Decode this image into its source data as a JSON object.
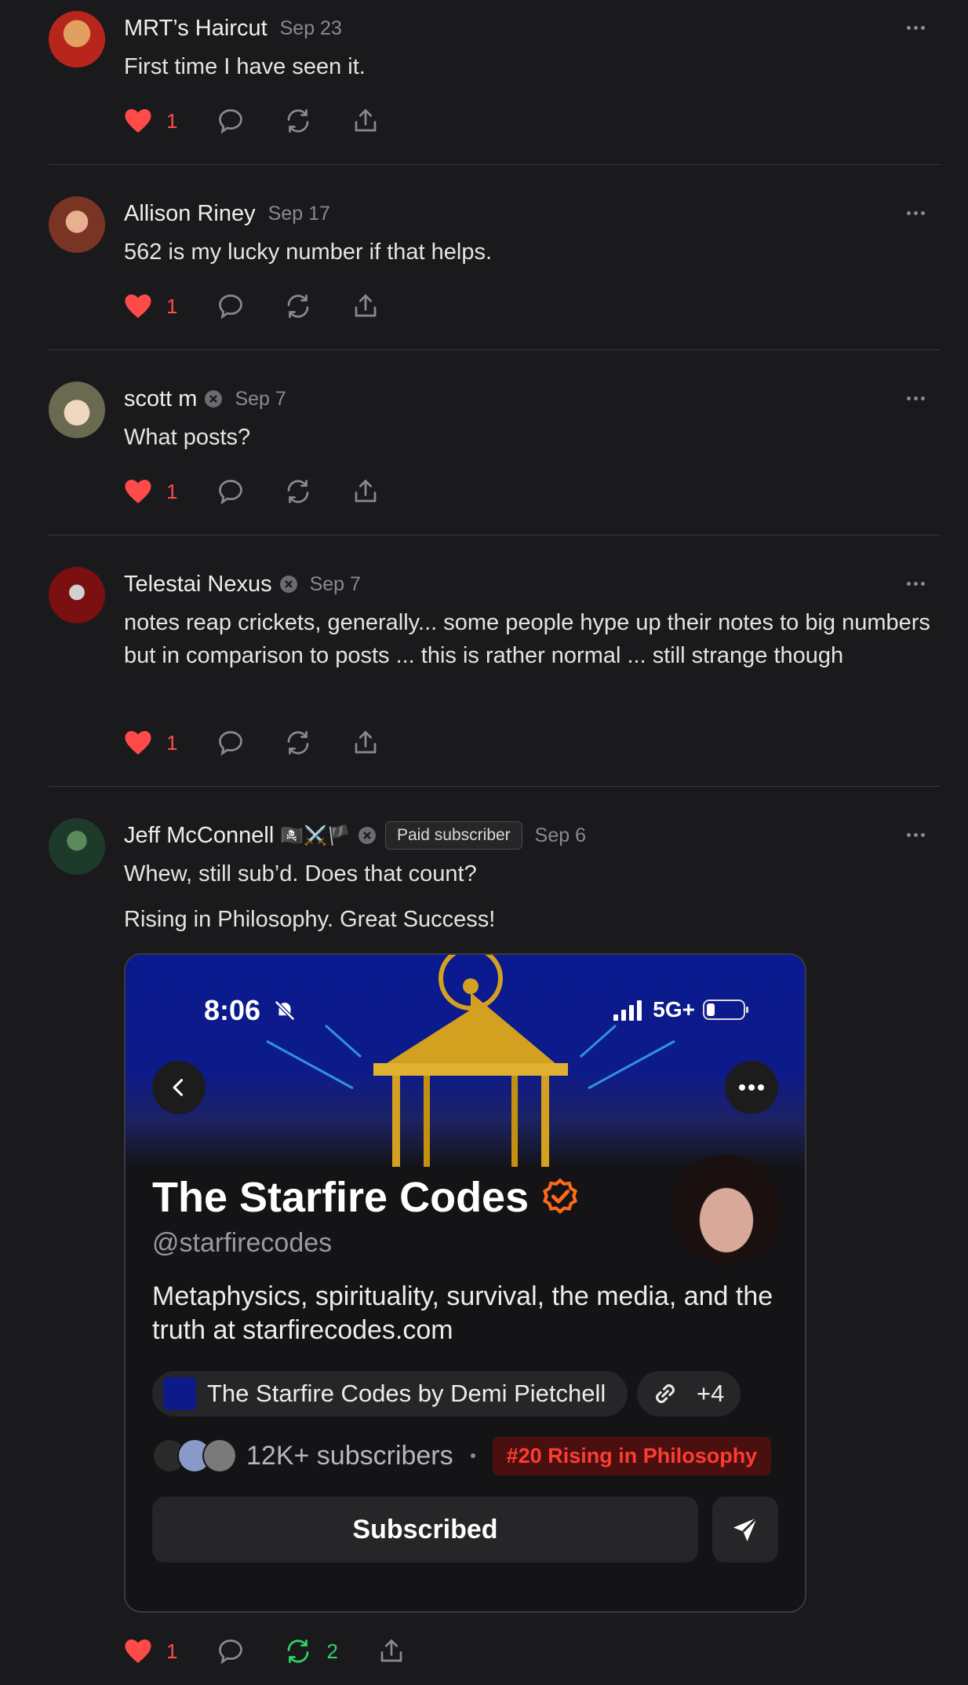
{
  "comments": [
    {
      "author": "MRT’s Haircut",
      "date": "Sep 23",
      "text": "First time I have seen it.",
      "likes": "1",
      "avatar_colors": [
        "#b8251c",
        "#e0a060"
      ]
    },
    {
      "author": "Allison Riney",
      "date": "Sep 17",
      "text": "562 is my lucky number if that helps.",
      "likes": "1",
      "avatar_colors": [
        "#5a2a20",
        "#c47a55"
      ]
    },
    {
      "author": "scott m",
      "date": "Sep 7",
      "text": "What posts?",
      "likes": "1",
      "avatar_colors": [
        "#8a7a5a",
        "#d8c8a8"
      ]
    },
    {
      "author": "Telestai Nexus",
      "date": "Sep 7",
      "text": "notes reap crickets, generally... some people hype up their notes to big numbers but in comparison to posts ... this is rather normal ... still strange though",
      "likes": "1",
      "avatar_colors": [
        "#7a1010",
        "#d0d0d0"
      ]
    },
    {
      "author": "Jeff McConnell",
      "author_emoji": "🏴‍☠️⚔️🏴",
      "paid_badge": "Paid subscriber",
      "date": "Sep 6",
      "text": "Whew, still sub’d. Does that count?",
      "text2": "Rising in Philosophy. Great Success!",
      "likes": "1",
      "restacks": "2",
      "avatar_colors": [
        "#1e3a2a",
        "#5a8a5a"
      ]
    }
  ],
  "card": {
    "status_time": "8:06",
    "network": "5G+",
    "title": "The Starfire Codes",
    "handle": "@starfirecodes",
    "description": "Metaphysics, spirituality, survival, the media, and the truth at starfirecodes.com",
    "publication_chip": "The Starfire Codes by Demi Pietchell",
    "links_chip": "+4",
    "subscribers": "12K+ subscribers",
    "rising_badge": "#20 Rising in Philosophy",
    "subscribe_button": "Subscribed"
  },
  "colors": {
    "background": "#1a1a1c",
    "heart": "#ff4a4a",
    "restack_active": "#2fd46a",
    "verified_orange": "#ff6a1a",
    "hero_blue": "#0d1b8a"
  }
}
